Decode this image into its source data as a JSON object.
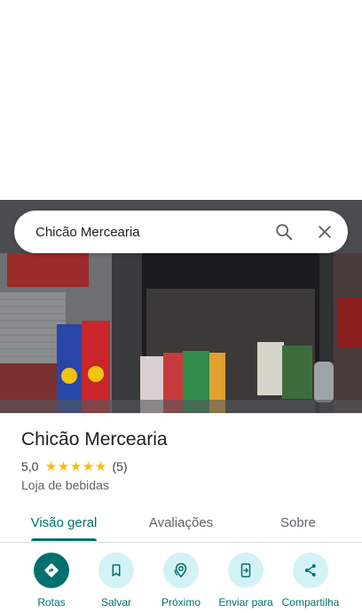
{
  "search": {
    "query": "Chicão Mercearia"
  },
  "place": {
    "name": "Chicão Mercearia",
    "rating": "5,0",
    "rating_value": 5,
    "stars": [
      "★",
      "★",
      "★",
      "★",
      "★"
    ],
    "review_count": "(5)",
    "category": "Loja de bebidas"
  },
  "tabs": [
    {
      "label": "Visão geral",
      "active": true
    },
    {
      "label": "Avaliações",
      "active": false
    },
    {
      "label": "Sobre",
      "active": false
    }
  ],
  "actions": [
    {
      "label": "Rotas",
      "icon": "directions-icon"
    },
    {
      "label": "Salvar",
      "icon": "bookmark-icon"
    },
    {
      "label": "Próximo",
      "icon": "nearby-icon"
    },
    {
      "label": "Enviar para",
      "icon": "send-to-phone-icon"
    },
    {
      "label": "Compartilha",
      "icon": "share-icon"
    }
  ],
  "colors": {
    "accent": "#00706e",
    "action_bg": "#d3f2f5",
    "star": "#fbbc04"
  }
}
